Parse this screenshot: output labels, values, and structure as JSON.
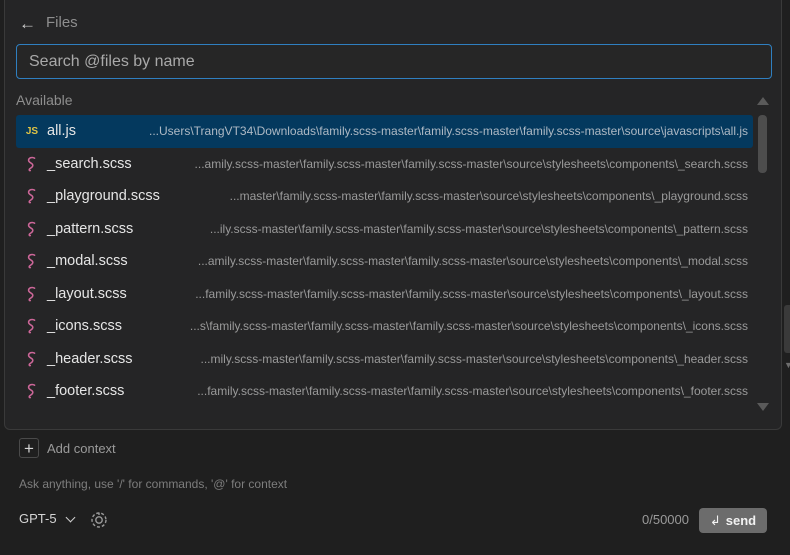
{
  "picker": {
    "title": "Files",
    "search_placeholder": "Search @files by name",
    "section_label": "Available",
    "files": [
      {
        "name": "all.js",
        "icon": "js",
        "path": "...Users\\TrangVT34\\Downloads\\family.scss-master\\family.scss-master\\family.scss-master\\source\\javascripts\\all.js",
        "selected": true
      },
      {
        "name": "_search.scss",
        "icon": "sass",
        "path": "...amily.scss-master\\family.scss-master\\family.scss-master\\source\\stylesheets\\components\\_search.scss"
      },
      {
        "name": "_playground.scss",
        "icon": "sass",
        "path": "...master\\family.scss-master\\family.scss-master\\source\\stylesheets\\components\\_playground.scss"
      },
      {
        "name": "_pattern.scss",
        "icon": "sass",
        "path": "...ily.scss-master\\family.scss-master\\family.scss-master\\source\\stylesheets\\components\\_pattern.scss"
      },
      {
        "name": "_modal.scss",
        "icon": "sass",
        "path": "...amily.scss-master\\family.scss-master\\family.scss-master\\source\\stylesheets\\components\\_modal.scss"
      },
      {
        "name": "_layout.scss",
        "icon": "sass",
        "path": "...family.scss-master\\family.scss-master\\family.scss-master\\source\\stylesheets\\components\\_layout.scss"
      },
      {
        "name": "_icons.scss",
        "icon": "sass",
        "path": "...s\\family.scss-master\\family.scss-master\\family.scss-master\\source\\stylesheets\\components\\_icons.scss"
      },
      {
        "name": "_header.scss",
        "icon": "sass",
        "path": "...mily.scss-master\\family.scss-master\\family.scss-master\\source\\stylesheets\\components\\_header.scss"
      },
      {
        "name": "_footer.scss",
        "icon": "sass",
        "path": "...family.scss-master\\family.scss-master\\family.scss-master\\source\\stylesheets\\components\\_footer.scss"
      }
    ]
  },
  "composer": {
    "add_context_label": "Add context",
    "hint": "Ask anything, use '/' for commands, '@' for context",
    "model": "GPT-5",
    "counter": "0/50000",
    "send_label": "send",
    "send_icon": "enter-icon"
  },
  "colors": {
    "accent": "#2f7fc0",
    "selected_row": "#04395e",
    "js_icon": "#e0c345",
    "sass_icon": "#cd6799"
  }
}
